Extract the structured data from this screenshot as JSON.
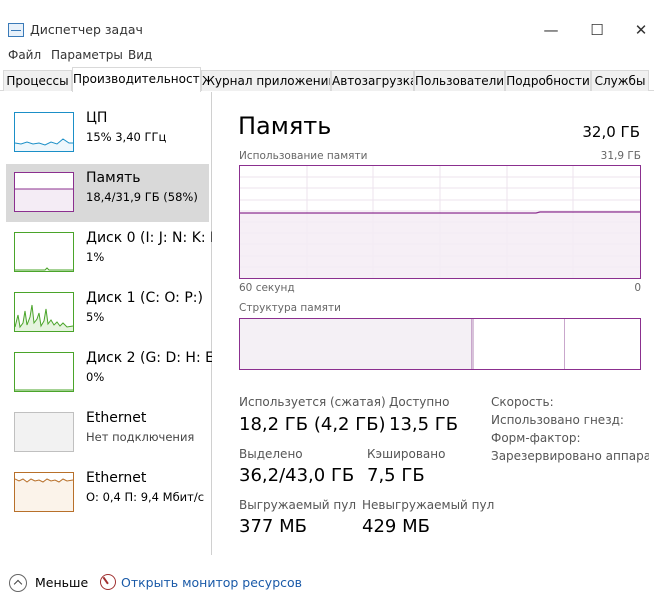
{
  "window": {
    "title": "Диспетчер задач"
  },
  "menu": [
    "Файл",
    "Параметры",
    "Вид"
  ],
  "tabs": [
    {
      "label": "Процессы",
      "active": false
    },
    {
      "label": "Производительность",
      "active": true
    },
    {
      "label": "Журнал приложений",
      "active": false
    },
    {
      "label": "Автозагрузка",
      "active": false
    },
    {
      "label": "Пользователи",
      "active": false
    },
    {
      "label": "Подробности",
      "active": false
    },
    {
      "label": "Службы",
      "active": false
    }
  ],
  "resources": [
    {
      "title": "ЦП",
      "sub": "15% 3,40 ГГц",
      "color": "#1b8fc7",
      "fill": "#eef7fc"
    },
    {
      "title": "Память",
      "sub": "18,4/31,9 ГБ (58%)",
      "color": "#8b2f8f",
      "fill": "#f4ecf5"
    },
    {
      "title": "Диск 0 (I: J: N: K: L:",
      "sub": "1%",
      "color": "#4aa42a",
      "fill": "#f2f9ef"
    },
    {
      "title": "Диск 1 (C: O: P:)",
      "sub": "5%",
      "color": "#4aa42a",
      "fill": "#e6f4df"
    },
    {
      "title": "Диск 2 (G: D: H: E:",
      "sub": "0%",
      "color": "#4aa42a",
      "fill": "#f2f9ef"
    },
    {
      "title": "Ethernet",
      "sub": "Нет подключения",
      "color": "#c0c0c0",
      "fill": "#f2f2f2"
    },
    {
      "title": "Ethernet",
      "sub": "О: 0,4  П: 9,4 Мбит/с",
      "color": "#b8702a",
      "fill": "#fbf3ea"
    }
  ],
  "detail": {
    "title": "Память",
    "total": "32,0 ГБ",
    "usage_label": "Использование памяти",
    "usage_max": "31,9 ГБ",
    "usage_percent": 58,
    "time_label": "60 секунд",
    "time_end": "0",
    "composition_label": "Структура памяти",
    "stats": {
      "in_use_label": "Используется (сжатая)",
      "in_use_value": "18,2 ГБ (4,2 ГБ)",
      "available_label": "Доступно",
      "available_value": "13,5 ГБ",
      "committed_label": "Выделено",
      "committed_value": "36,2/43,0 ГБ",
      "cached_label": "Кэшировано",
      "cached_value": "7,5 ГБ",
      "paged_label": "Выгружаемый пул",
      "paged_value": "377 МБ",
      "nonpaged_label": "Невыгружаемый пул",
      "nonpaged_value": "429 МБ"
    },
    "side": [
      "Скорость:",
      "Использовано гнезд:",
      "Форм-фактор:",
      "Зарезервировано аппара..."
    ]
  },
  "footer": {
    "fewer_label": "Меньше",
    "monitor_link": "Открыть монитор ресурсов"
  }
}
